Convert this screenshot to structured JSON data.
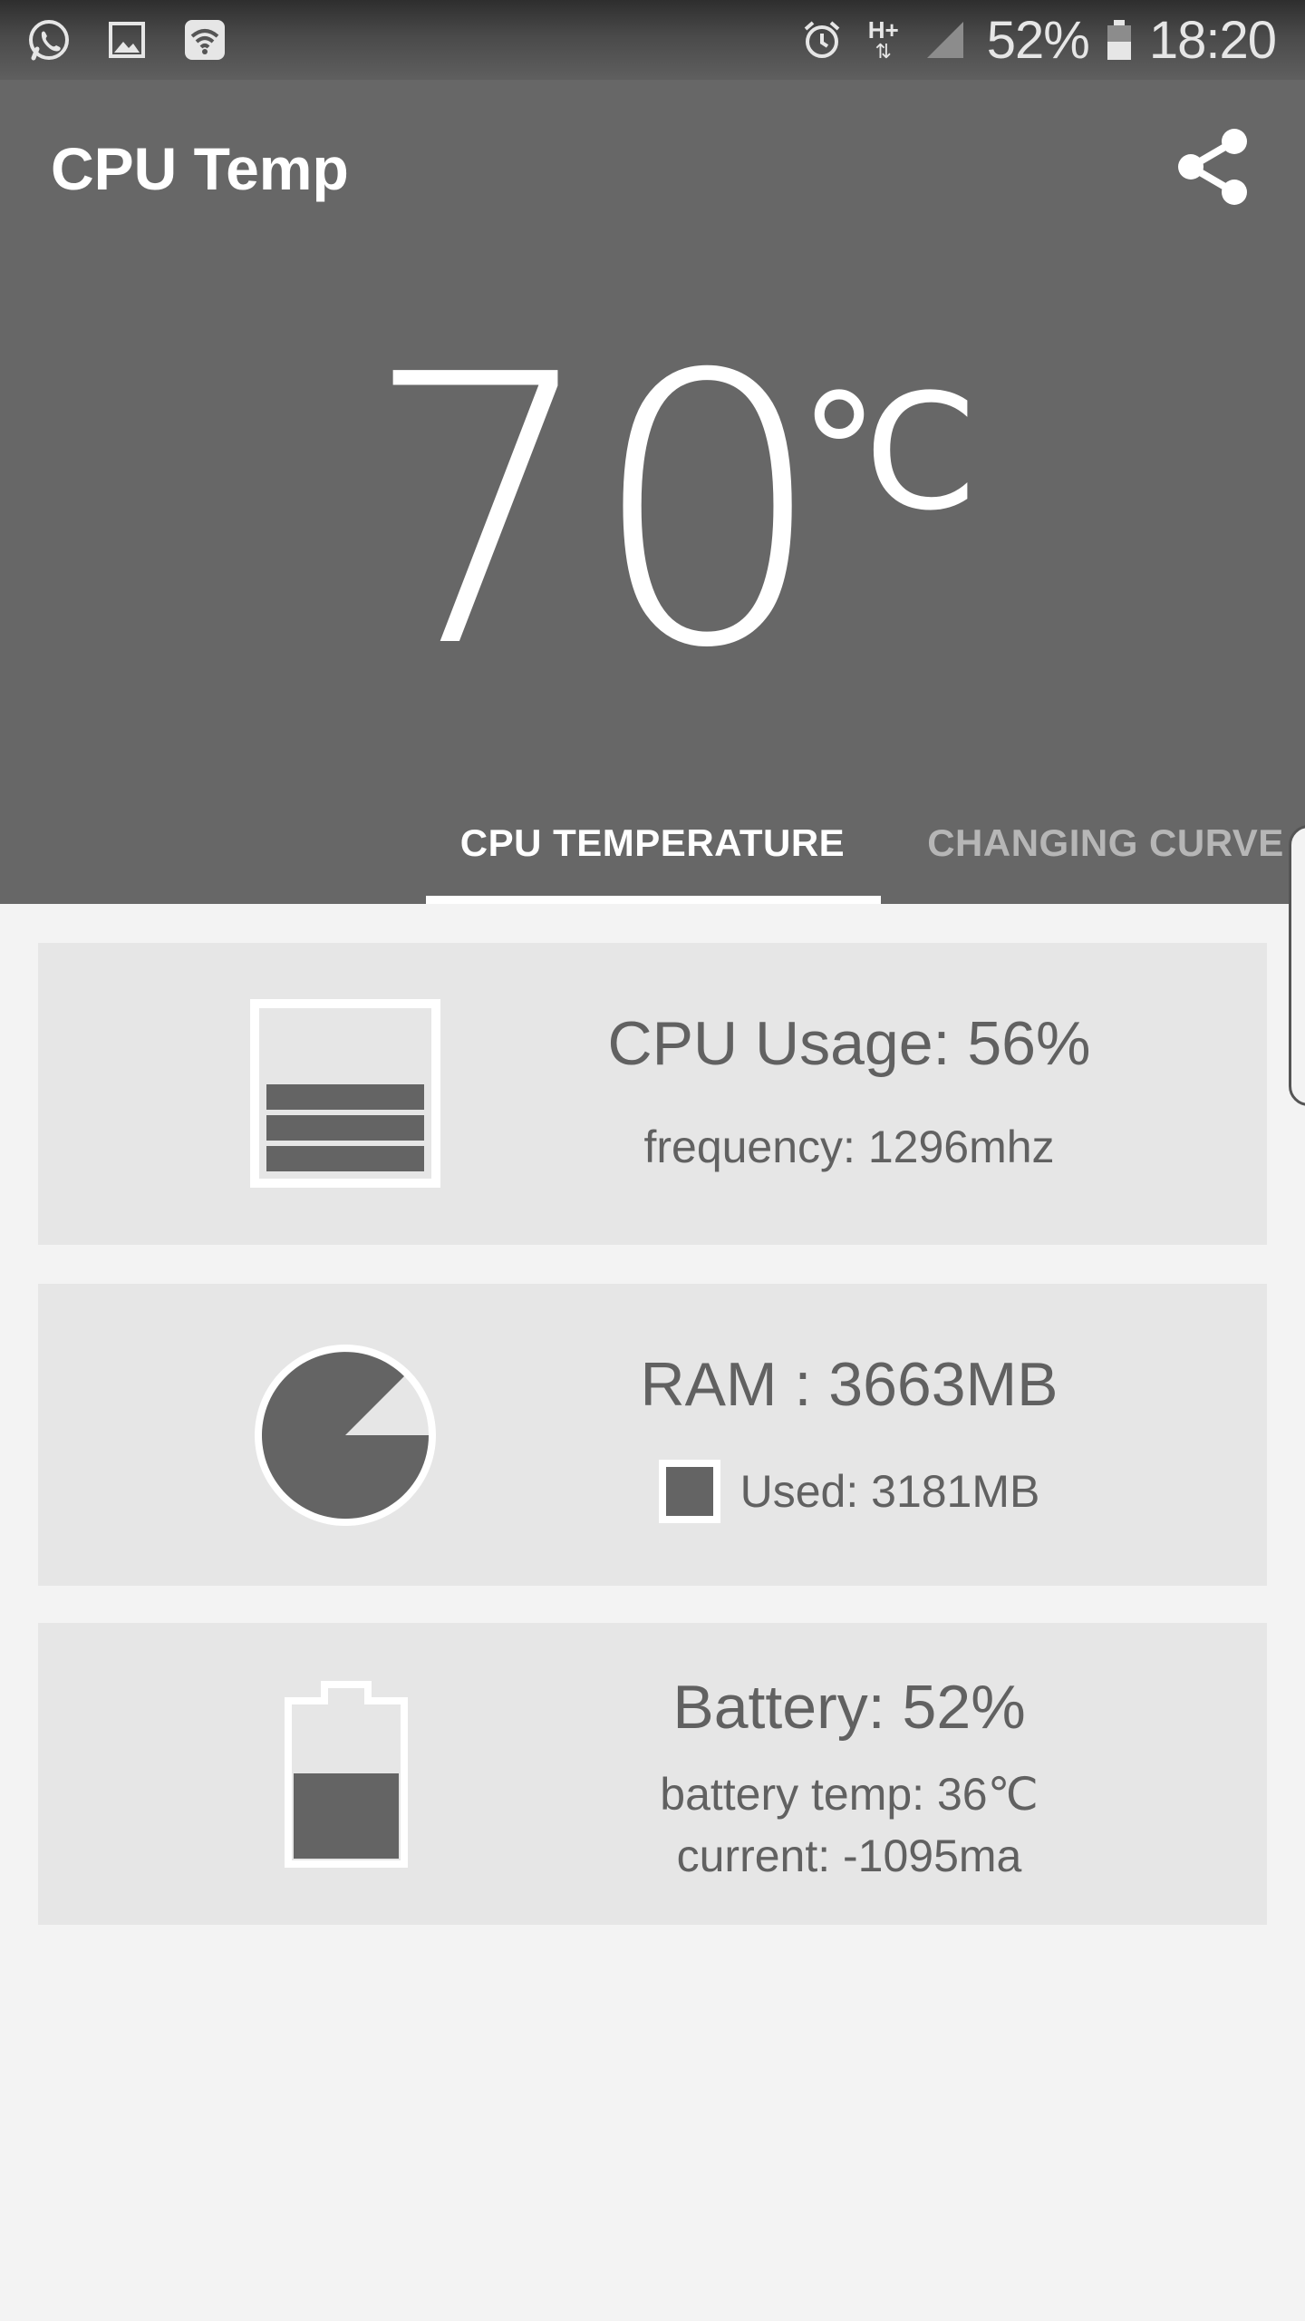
{
  "status_bar": {
    "left_icons": [
      "whatsapp-icon",
      "gallery-icon",
      "wifi-icon"
    ],
    "right_icons": [
      "alarm-icon",
      "hplus-data-icon",
      "signal-icon",
      "battery-icon"
    ],
    "network_label": "H+",
    "battery_percent": "52%",
    "time": "18:20"
  },
  "app_bar": {
    "title": "CPU Temp",
    "share_icon": "share-icon"
  },
  "temperature": {
    "value": "70",
    "unit": "℃"
  },
  "tabs": [
    {
      "label": "CPU TEMPERATURE",
      "active": true
    },
    {
      "label": "CHANGING CURVE",
      "active": false
    }
  ],
  "cards": {
    "cpu": {
      "title": "CPU Usage: 56%",
      "subtitle": "frequency: 1296mhz",
      "icon": "cpu-usage-icon",
      "usage_fraction": 0.56
    },
    "ram": {
      "title": "RAM : 3663MB",
      "legend": "Used: 3181MB",
      "icon": "ram-pie-icon",
      "used_fraction": 0.87
    },
    "battery": {
      "title": "Battery: 52%",
      "temp": "battery temp: 36℃",
      "current": "current: -1095ma",
      "icon": "battery-level-icon",
      "level_fraction": 0.52
    }
  },
  "colors": {
    "header": "#676767",
    "background": "#f3f3f3",
    "card": "#e6e6e6",
    "text": "#616161",
    "fill": "#646464",
    "tab_inactive": "#b6b6b6"
  }
}
